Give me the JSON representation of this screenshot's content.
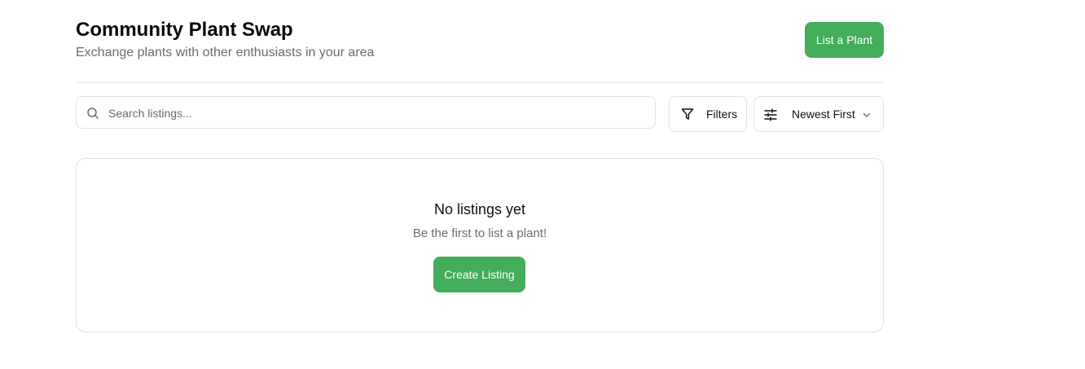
{
  "header": {
    "title": "Community Plant Swap",
    "subtitle": "Exchange plants with other enthusiasts in your area",
    "list_button_label": "List a Plant"
  },
  "toolbar": {
    "search": {
      "placeholder": "Search listings...",
      "value": ""
    },
    "filters_label": "Filters",
    "sort_selected": "Newest First"
  },
  "empty_state": {
    "title": "No listings yet",
    "message": "Be the first to list a plant!",
    "button_label": "Create Listing"
  },
  "colors": {
    "accent": "#43ad5a",
    "border": "#e2e2e2",
    "muted_text": "#6b6b6b"
  },
  "icons": {
    "search": "search-icon",
    "filters": "filter-funnel-icon",
    "sort": "sliders-icon",
    "dropdown": "chevron-down-icon"
  }
}
